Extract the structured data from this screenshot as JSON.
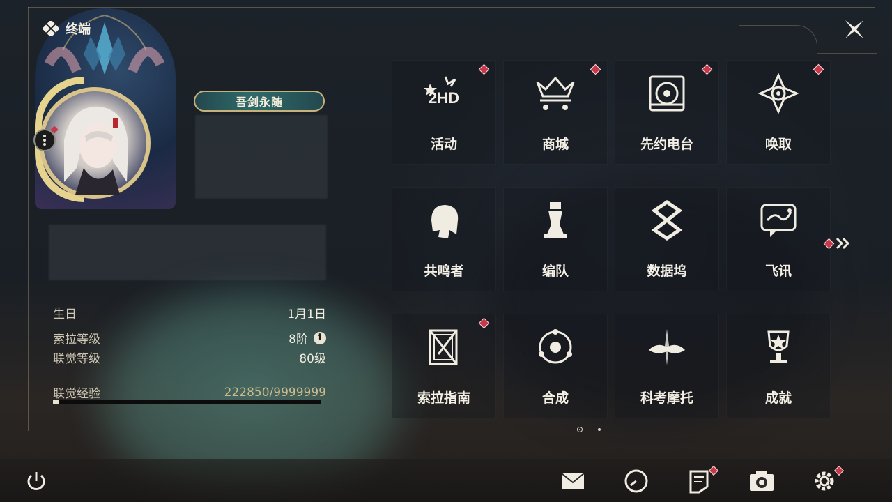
{
  "header": {
    "title": "终端"
  },
  "profile": {
    "title_badge": "吾剑永随",
    "info": [
      {
        "label": "生日",
        "value": "1月1日"
      },
      {
        "label": "索拉等级",
        "value": "8阶"
      },
      {
        "label": "联觉等级",
        "value": "80级"
      }
    ],
    "exp": {
      "label": "联觉经验",
      "value": "222850/9999999",
      "progress_fraction": 0.022
    }
  },
  "menu": [
    {
      "label": "活动",
      "icon": "event-2hd-icon",
      "has_notification": true
    },
    {
      "label": "商城",
      "icon": "shop-crown-cart-icon",
      "has_notification": true
    },
    {
      "label": "先约电台",
      "icon": "radio-record-icon",
      "has_notification": true
    },
    {
      "label": "唤取",
      "icon": "convene-star-icon",
      "has_notification": true
    },
    {
      "label": "共鸣者",
      "icon": "resonator-head-icon",
      "has_notification": false
    },
    {
      "label": "编队",
      "icon": "team-chess-icon",
      "has_notification": false
    },
    {
      "label": "数据坞",
      "icon": "data-bank-icon",
      "has_notification": false
    },
    {
      "label": "飞讯",
      "icon": "message-chat-icon",
      "has_notification": false
    },
    {
      "label": "索拉指南",
      "icon": "guide-book-icon",
      "has_notification": true
    },
    {
      "label": "合成",
      "icon": "synthesis-orbit-icon",
      "has_notification": false
    },
    {
      "label": "科考摩托",
      "icon": "motorbike-icon",
      "has_notification": false
    },
    {
      "label": "成就",
      "icon": "achievement-trophy-icon",
      "has_notification": false
    }
  ],
  "pager": {
    "current": 1,
    "total": 2
  },
  "bottom_bar": [
    {
      "icon": "mail-icon",
      "has_notification": false
    },
    {
      "icon": "clock-icon",
      "has_notification": false
    },
    {
      "icon": "notice-icon",
      "has_notification": true
    },
    {
      "icon": "camera-icon",
      "has_notification": false
    },
    {
      "icon": "settings-gear-icon",
      "has_notification": true
    }
  ],
  "colors": {
    "accent_gold": "#c9b27a",
    "notification_red": "#c7394a",
    "text_light": "#f4f0e6"
  }
}
